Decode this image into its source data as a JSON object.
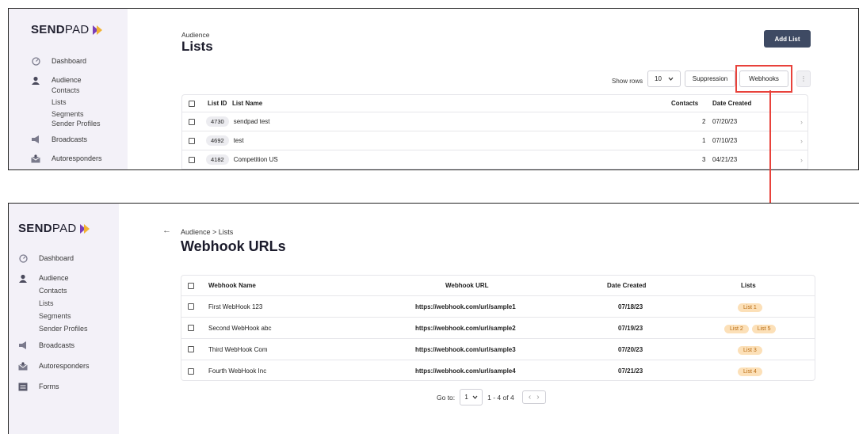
{
  "colors": {
    "sidebar": "#f3f1f8",
    "accent": "#3e4a63",
    "highlight": "#e8423b",
    "list_pill": "#fce0b8"
  },
  "brand": {
    "bold": "SEND",
    "light": "PAD"
  },
  "sidebar": {
    "items": [
      {
        "label": "Dashboard",
        "icon": "dashboard-icon"
      },
      {
        "label": "Audience",
        "icon": "audience-icon"
      },
      {
        "label": "Broadcasts",
        "icon": "megaphone-icon"
      },
      {
        "label": "Autoresponders",
        "icon": "autoresponder-icon"
      },
      {
        "label": "Forms",
        "icon": "forms-icon"
      }
    ],
    "sub_items": [
      "Contacts",
      "Lists",
      "Segments",
      "Sender Profiles"
    ]
  },
  "top": {
    "breadcrumb": "Audience",
    "title": "Lists",
    "add_list": "Add List",
    "show_rows_label": "Show rows",
    "show_rows_value": "10",
    "suppression": "Suppression",
    "webhooks": "Webhooks",
    "more": "⋮",
    "table": {
      "headers": {
        "id": "List ID",
        "name": "List Name",
        "contacts": "Contacts",
        "date": "Date Created"
      },
      "rows": [
        {
          "id": "4730",
          "name": "sendpad test",
          "contacts": "2",
          "date": "07/20/23"
        },
        {
          "id": "4692",
          "name": "test",
          "contacts": "1",
          "date": "07/10/23"
        },
        {
          "id": "4182",
          "name": "Competition US",
          "contacts": "3",
          "date": "04/21/23"
        }
      ]
    }
  },
  "bottom": {
    "breadcrumb": "Audience > Lists",
    "title": "Webhook URLs",
    "back": "←",
    "table": {
      "headers": {
        "name": "Webhook Name",
        "url": "Webhook URL",
        "date": "Date Created",
        "lists": "Lists"
      },
      "rows": [
        {
          "name": "First WebHook 123",
          "url": "https://webhook.com/url/sample1",
          "date": "07/18/23",
          "lists": [
            "List 1"
          ]
        },
        {
          "name": "Second WebHook abc",
          "url": "https://webhook.com/url/sample2",
          "date": "07/19/23",
          "lists": [
            "List 2",
            "List 5"
          ]
        },
        {
          "name": "Third WebHook Com",
          "url": "https://webhook.com/url/sample3",
          "date": "07/20/23",
          "lists": [
            "List 3"
          ]
        },
        {
          "name": "Fourth WebHook Inc",
          "url": "https://webhook.com/url/sample4",
          "date": "07/21/23",
          "lists": [
            "List 4"
          ]
        }
      ]
    },
    "pagination": {
      "goto_label": "Go to:",
      "page": "1",
      "range": "1 - 4 of 4"
    }
  }
}
